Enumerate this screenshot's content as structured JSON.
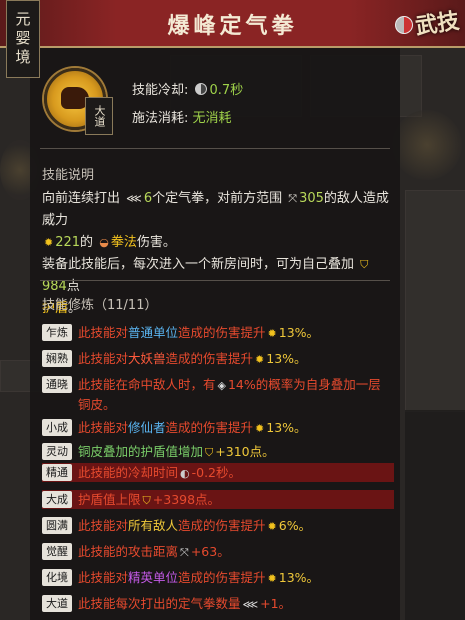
{
  "realm_tag": "元婴境",
  "title": "爆峰定气拳",
  "header_brush": "武技",
  "skill_badge": "大道",
  "stats": {
    "cooldown_label": "技能冷却:",
    "cooldown_value": "0.7秒",
    "cost_label": "施法消耗:",
    "cost_value": "无消耗"
  },
  "description": {
    "title": "技能说明",
    "line1_a": "向前连续打出",
    "line1_count": "6",
    "line1_b": "个定气拳，对前方范围",
    "line1_range": "305",
    "line1_c": "的敌人造成威力",
    "line2_power": "221",
    "line2_a": "的",
    "line2_type": "拳法",
    "line2_b": "伤害。",
    "line3_a": "装备此技能后，每次进入一个新房间时，可为自己叠加",
    "line3_shield": "984",
    "line3_b": "点",
    "line4_shield_word": "护盾",
    "line4_end": "。"
  },
  "mods_title": "技能修炼（11/11）",
  "mods": [
    {
      "tag": "乍炼",
      "a": "此技能对",
      "k": "普通单位",
      "b": "造成的伤害提升",
      "v": "13%。"
    },
    {
      "tag": "娴熟",
      "a": "此技能对",
      "k": "大妖兽",
      "b": "造成的伤害提升",
      "v": "13%。"
    },
    {
      "tag": "通晓",
      "a": "此技能在命中敌人时，有",
      "v": "14%的概率为自身叠加一层",
      "b": "铜皮。"
    },
    {
      "tag": "小成",
      "a": "此技能对",
      "k": "修仙者",
      "b": "造成的伤害提升",
      "v": "13%。"
    },
    {
      "tag": "灵动",
      "a": "铜皮叠加的护盾值增加",
      "v": "+310点。"
    },
    {
      "tag": "精通",
      "a": "此技能的冷却时间",
      "v": "-0.2秒。"
    },
    {
      "tag": "大成",
      "a": "护盾值上限",
      "v": "+3398点。"
    },
    {
      "tag": "圆满",
      "a": "此技能对",
      "k": "所有敌人",
      "b": "造成的伤害提升",
      "v": "6%。"
    },
    {
      "tag": "觉醒",
      "a": "此技能的攻击距离",
      "v": "+63。"
    },
    {
      "tag": "化境",
      "a": "此技能对",
      "k": "精英单位",
      "b": "造成的伤害提升",
      "v": "13%。"
    },
    {
      "tag": "大道",
      "a": "此技能每次打出的定气拳数量",
      "v": "+1。"
    }
  ]
}
